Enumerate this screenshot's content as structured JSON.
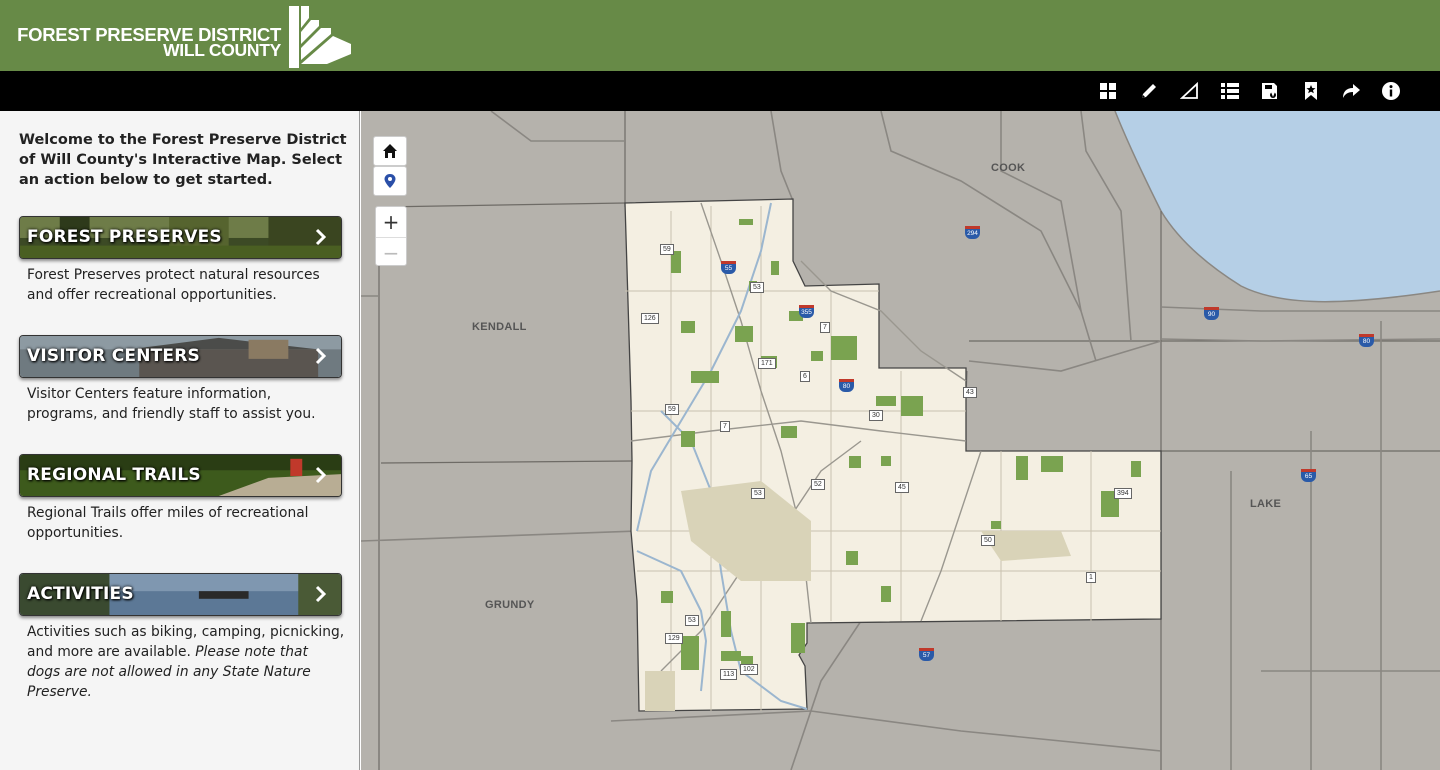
{
  "header": {
    "logo_line1": "FOREST PRESERVE DISTRICT",
    "logo_line2": "WILL COUNTY",
    "brand_color": "#678a47"
  },
  "toolbar": {
    "tools": [
      {
        "name": "basemap-gallery-icon"
      },
      {
        "name": "draw-icon"
      },
      {
        "name": "measure-icon"
      },
      {
        "name": "layer-list-icon"
      },
      {
        "name": "save-icon"
      },
      {
        "name": "bookmark-icon"
      },
      {
        "name": "share-icon"
      },
      {
        "name": "info-icon"
      }
    ]
  },
  "sidebar": {
    "welcome": "Welcome to the Forest Preserve District of Will County's Interactive Map. Select an action below to get started.",
    "categories": [
      {
        "label": "FOREST PRESERVES",
        "desc": "Forest Preserves protect natural resources and offer recreational opportunities."
      },
      {
        "label": "VISITOR CENTERS",
        "desc": "Visitor Centers feature information, programs, and friendly staff to assist you."
      },
      {
        "label": "REGIONAL TRAILS",
        "desc": "Regional Trails offer miles of recreational opportunities."
      },
      {
        "label": "ACTIVITIES",
        "desc": "Activities such as biking, camping, picnicking, and more are available.",
        "desc_note": "Please note that dogs are not allowed in any State Nature Preserve."
      }
    ]
  },
  "map": {
    "zoom_in": "+",
    "zoom_out": "−",
    "counties": [
      "COOK",
      "KENDALL",
      "GRUNDY",
      "LAKE"
    ],
    "routes": [
      "59",
      "55",
      "53",
      "126",
      "355",
      "7",
      "171",
      "6",
      "80",
      "43",
      "59",
      "30",
      "7",
      "53",
      "52",
      "45",
      "394",
      "50",
      "1",
      "53",
      "129",
      "102",
      "113",
      "57",
      "294",
      "90",
      "80",
      "65"
    ],
    "colors": {
      "land": "#b5b2ac",
      "will_county": "#f4efe2",
      "preserve": "#7aa350",
      "water": "#b5cfe6",
      "roads": "#8a8782"
    }
  }
}
